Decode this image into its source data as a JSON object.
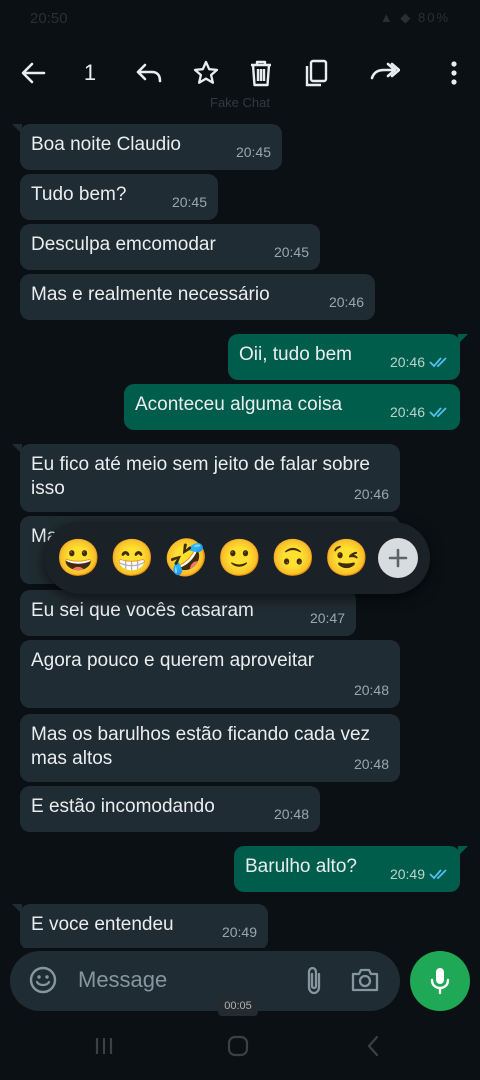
{
  "status_bar": {
    "time": "20:50",
    "system": "▲ ◆ 80%"
  },
  "topbar": {
    "selected_count": "1",
    "subtitle": "Fake Chat"
  },
  "messages": [
    {
      "text": "Boa noite Claudio",
      "time": "20:45",
      "dir": "in"
    },
    {
      "text": "Tudo bem?",
      "time": "20:45",
      "dir": "in"
    },
    {
      "text": "Desculpa emcomodar",
      "time": "20:45",
      "dir": "in"
    },
    {
      "text": "Mas e realmente necessário",
      "time": "20:46",
      "dir": "in"
    },
    {
      "text": "Oii, tudo bem",
      "time": "20:46",
      "dir": "out"
    },
    {
      "text": "Aconteceu alguma coisa",
      "time": "20:46",
      "dir": "out"
    },
    {
      "text": "Eu fico até meio sem jeito de falar sobre isso",
      "time": "20:46",
      "dir": "in"
    },
    {
      "text": "Ma",
      "time": "",
      "dir": "in"
    },
    {
      "text": "Eu sei que vocês casaram",
      "time": "20:47",
      "dir": "in"
    },
    {
      "text": "Agora pouco e querem aproveitar",
      "time": "20:48",
      "dir": "in"
    },
    {
      "text": "Mas os barulhos estão ficando cada vez mas altos",
      "time": "20:48",
      "dir": "in"
    },
    {
      "text": "E estão incomodando",
      "time": "20:48",
      "dir": "in"
    },
    {
      "text": "Barulho alto?",
      "time": "20:49",
      "dir": "out"
    },
    {
      "text": "E voce entendeu",
      "time": "20:49",
      "dir": "in"
    }
  ],
  "reactions": [
    "😀",
    "😁",
    "🤣",
    "🙂",
    "🙃",
    "😉"
  ],
  "composer": {
    "placeholder": "Message"
  },
  "video_timer": "00:05",
  "colors": {
    "incoming": "#202c33",
    "outgoing": "#005c4b",
    "accent": "#1fa855",
    "read_ticks": "#53bdeb"
  }
}
